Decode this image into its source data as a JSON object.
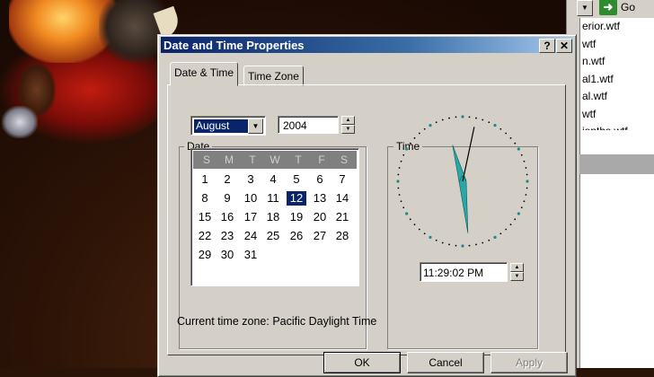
{
  "explorer": {
    "go_label": "Go",
    "files": [
      "erior.wtf",
      "wtf",
      "n.wtf",
      "al1.wtf",
      "al.wtf",
      "wtf",
      "ionths.wtf"
    ]
  },
  "dialog": {
    "title": "Date and Time Properties",
    "help_label": "?",
    "close_label": "✕",
    "tabs": [
      "Date & Time",
      "Time Zone"
    ],
    "date_group_label": "Date",
    "time_group_label": "Time",
    "month": "August",
    "year": "2004",
    "days_of_week": [
      "S",
      "M",
      "T",
      "W",
      "T",
      "F",
      "S"
    ],
    "calendar_start_weekday": 0,
    "days_in_month": 31,
    "selected_day": 12,
    "time": "11:29:02 PM",
    "clock": {
      "hour": 11,
      "minute": 29,
      "second": 2
    },
    "current_zone_label": "Current time zone:",
    "current_zone_value": "Pacific Daylight Time",
    "buttons": {
      "ok": "OK",
      "cancel": "Cancel",
      "apply": "Apply"
    }
  },
  "colors": {
    "titlebar": "#0a246a",
    "selection": "#0a246a",
    "clock_dot": "#1a8a8a",
    "dialog_face": "#d4d0c8"
  },
  "icons": {
    "go": "go-arrow-icon",
    "dropdown": "chevron-down-icon"
  }
}
